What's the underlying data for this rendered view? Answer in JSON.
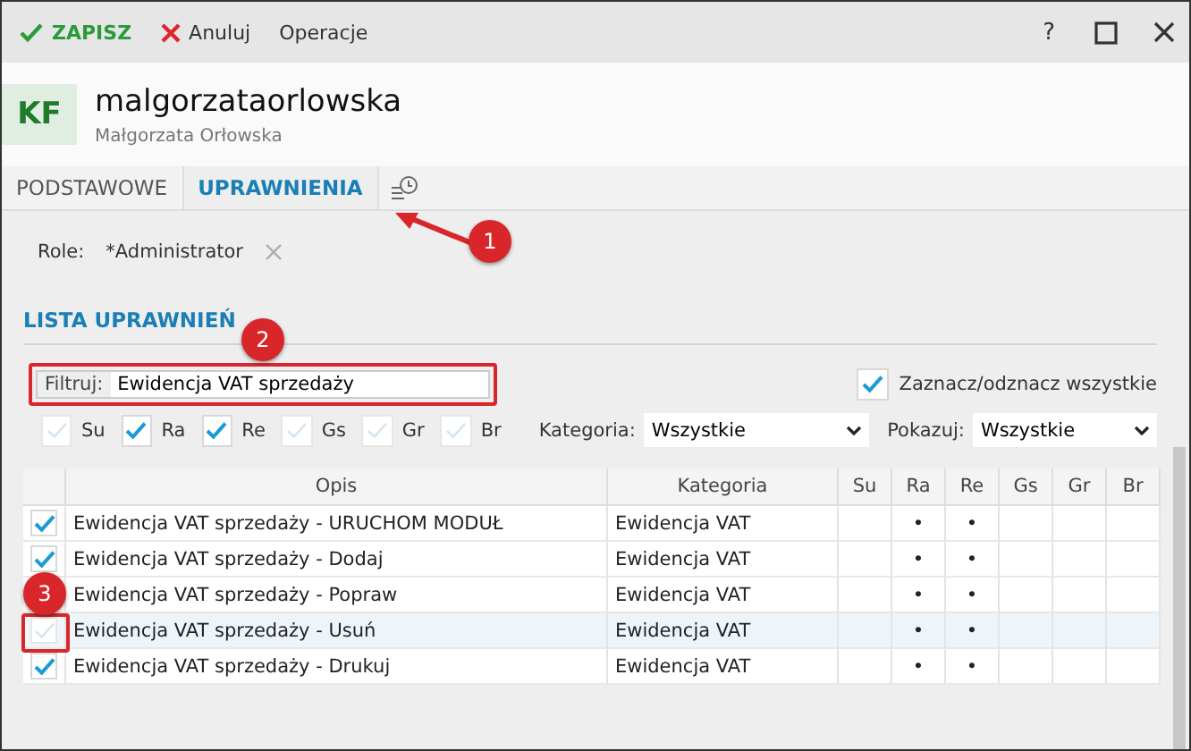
{
  "toolbar": {
    "save": "ZAPISZ",
    "cancel": "Anuluj",
    "operations": "Operacje",
    "help": "?"
  },
  "header": {
    "initials": "KF",
    "login": "malgorzataorlowska",
    "full_name": "Małgorzata Orłowska"
  },
  "tabs": [
    {
      "label": "PODSTAWOWE",
      "selected": false
    },
    {
      "label": "UPRAWNIENIA",
      "selected": true
    }
  ],
  "role": {
    "label": "Role:",
    "value": "*Administrator"
  },
  "section_title": "LISTA UPRAWNIEŃ",
  "filter": {
    "label": "Filtruj:",
    "value": "Ewidencja VAT sprzedaży",
    "highlighted": true
  },
  "select_all": {
    "label": "Zaznacz/odznacz wszystkie",
    "checked": true
  },
  "flags": [
    {
      "label": "Su",
      "checked": false
    },
    {
      "label": "Ra",
      "checked": true
    },
    {
      "label": "Re",
      "checked": true
    },
    {
      "label": "Gs",
      "checked": false
    },
    {
      "label": "Gr",
      "checked": false
    },
    {
      "label": "Br",
      "checked": false
    }
  ],
  "category": {
    "label": "Kategoria:",
    "value": "Wszystkie"
  },
  "show": {
    "label": "Pokazuj:",
    "value": "Wszystkie"
  },
  "table": {
    "columns": [
      "Opis",
      "Kategoria",
      "Su",
      "Ra",
      "Re",
      "Gs",
      "Gr",
      "Br"
    ],
    "rows": [
      {
        "checked": true,
        "selected": false,
        "cells": [
          "Ewidencja VAT sprzedaży - URUCHOM MODUŁ",
          "Ewidencja VAT",
          "",
          "•",
          "•",
          "",
          "",
          ""
        ]
      },
      {
        "checked": true,
        "selected": false,
        "cells": [
          "Ewidencja VAT sprzedaży - Dodaj",
          "Ewidencja VAT",
          "",
          "•",
          "•",
          "",
          "",
          ""
        ]
      },
      {
        "selected": false,
        "cells": [
          "Ewidencja VAT sprzedaży - Popraw",
          "Ewidencja VAT",
          "",
          "•",
          "•",
          "",
          "",
          ""
        ]
      },
      {
        "checked": false,
        "selected": true,
        "cells": [
          "Ewidencja VAT sprzedaży -  Usuń",
          "Ewidencja VAT",
          "",
          "•",
          "•",
          "",
          "",
          ""
        ]
      },
      {
        "checked": true,
        "selected": false,
        "cells": [
          "Ewidencja VAT sprzedaży - Drukuj",
          "Ewidencja VAT",
          "",
          "•",
          "•",
          "",
          "",
          ""
        ]
      }
    ]
  },
  "annotations": [
    {
      "label": "1"
    },
    {
      "label": "2"
    },
    {
      "label": "3"
    }
  ]
}
